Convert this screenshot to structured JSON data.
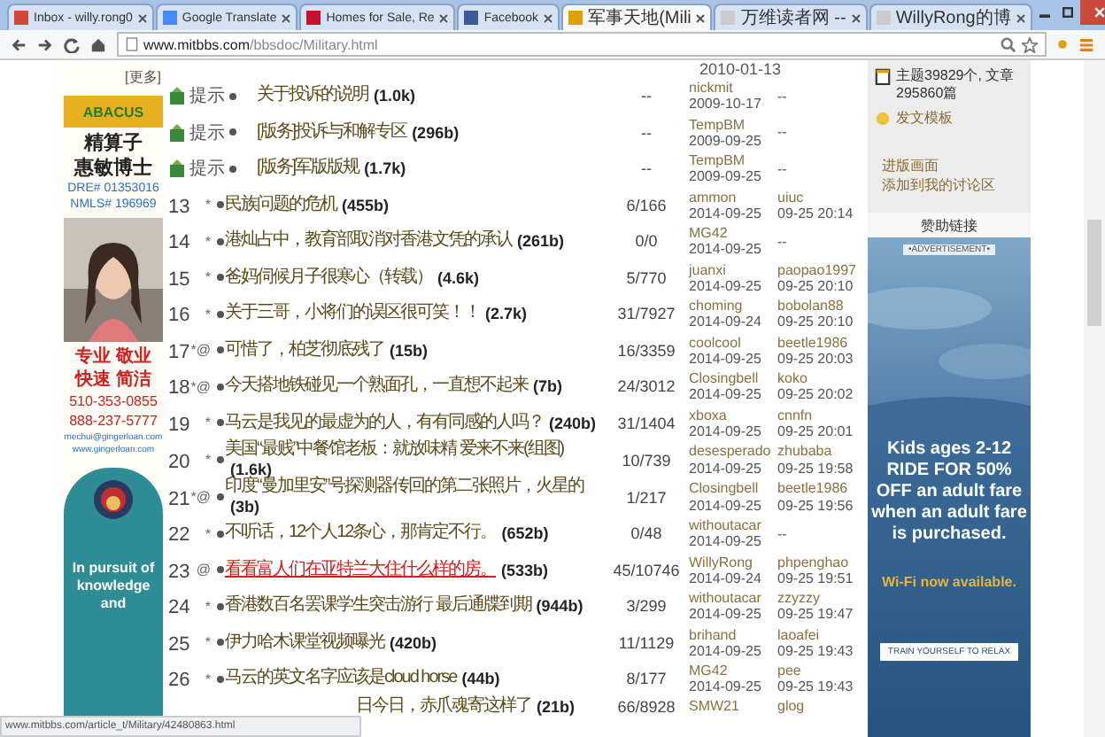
{
  "tabs": [
    {
      "label": "Inbox - willy.rong0",
      "selected": false,
      "color": "#d44638"
    },
    {
      "label": "Google Translate",
      "selected": false,
      "color": "#4a8af4"
    },
    {
      "label": "Homes for Sale, Re",
      "selected": false,
      "color": "#c8102e"
    },
    {
      "label": "Facebook",
      "selected": false,
      "color": "#3b5998"
    },
    {
      "label": "军事天地(Mili",
      "selected": true,
      "color": "#e0a000"
    },
    {
      "label": "万维读者网 --",
      "selected": false,
      "color": "#cccccc"
    },
    {
      "label": "WillyRong的博",
      "selected": false,
      "color": "#cccccc"
    }
  ],
  "address": {
    "host": "www.mitbbs.com",
    "path": "/bbsdoc/Military.html"
  },
  "left_ad": {
    "more": "[更多]",
    "logo": "ABACUS",
    "name_lines": [
      "精算子",
      "惠敏博士"
    ],
    "licenses": [
      "DRE# 01353016",
      "NMLS# 196969"
    ],
    "slogans": [
      "专业 敬业",
      "快速 简洁"
    ],
    "phones": [
      "510-353-0855",
      "888-237-5777"
    ],
    "email": "mechui@gingerloan.com",
    "site": "www.gingerloan.com",
    "motto": "In pursuit of knowledge and"
  },
  "top_date": "2010-01-13",
  "rows": [
    {
      "kind": "notice",
      "number": "",
      "tag": "提示",
      "marker": "",
      "title": "关于投诉的说明",
      "size": "(1.0k)",
      "stats": "--",
      "author": "nickmit",
      "date": "2009-10-17",
      "last_user": "",
      "last_time": "--",
      "visited": false
    },
    {
      "kind": "notice",
      "number": "",
      "tag": "提示",
      "marker": "",
      "title": "[版务]投诉与和解专区",
      "size": "(296b)",
      "stats": "--",
      "author": "TempBM",
      "date": "2009-09-25",
      "last_user": "",
      "last_time": "--",
      "visited": false
    },
    {
      "kind": "notice",
      "number": "",
      "tag": "提示",
      "marker": "",
      "title": "[版务]军版版规",
      "size": "(1.7k)",
      "stats": "--",
      "author": "TempBM",
      "date": "2009-09-25",
      "last_user": "",
      "last_time": "--",
      "visited": false
    },
    {
      "kind": "post",
      "number": "13",
      "tag": "",
      "marker": "*",
      "title": "民族问题的危机",
      "size": "(455b)",
      "stats": "6/166",
      "author": "ammon",
      "date": "2014-09-25",
      "last_user": "uiuc",
      "last_time": "09-25 20:14",
      "visited": false
    },
    {
      "kind": "post",
      "number": "14",
      "tag": "",
      "marker": "*",
      "title": "港灿占中，教育部取消对香港文凭的承认",
      "size": "(261b)",
      "stats": "0/0",
      "author": "MG42",
      "date": "2014-09-25",
      "last_user": "",
      "last_time": "--",
      "visited": false
    },
    {
      "kind": "post",
      "number": "15",
      "tag": "",
      "marker": "*",
      "title": "爸妈伺候月子很寒心（转载）",
      "size": "(4.6k)",
      "stats": "5/770",
      "author": "juanxi",
      "date": "2014-09-25",
      "last_user": "paopao1997",
      "last_time": "09-25 20:10",
      "visited": false
    },
    {
      "kind": "post",
      "number": "16",
      "tag": "",
      "marker": "*",
      "title": "关于三哥，小将们的误区很可笑！！",
      "size": "(2.7k)",
      "stats": "31/7927",
      "author": "choming",
      "date": "2014-09-24",
      "last_user": "bobolan88",
      "last_time": "09-25 20:10",
      "visited": false
    },
    {
      "kind": "post",
      "number": "17",
      "tag": "",
      "marker": "*@",
      "title": "可惜了，柏芝彻底残了",
      "size": "(15b)",
      "stats": "16/3359",
      "author": "coolcool",
      "date": "2014-09-25",
      "last_user": "beetle1986",
      "last_time": "09-25 20:03",
      "visited": false
    },
    {
      "kind": "post",
      "number": "18",
      "tag": "",
      "marker": "*@",
      "title": "今天搭地铁碰见一个熟面孔，一直想不起来",
      "size": "(7b)",
      "stats": "24/3012",
      "author": "Closingbell",
      "date": "2014-09-25",
      "last_user": "koko",
      "last_time": "09-25 20:02",
      "visited": false
    },
    {
      "kind": "post",
      "number": "19",
      "tag": "",
      "marker": "*",
      "title": "马云是我见的最虚为的人，有有同感的人吗？",
      "size": "(240b)",
      "stats": "31/1404",
      "author": "xboxa",
      "date": "2014-09-25",
      "last_user": "cnnfn",
      "last_time": "09-25 20:01",
      "visited": false
    },
    {
      "kind": "post",
      "number": "20",
      "tag": "",
      "marker": "*",
      "title": "美国“最贱”中餐馆老板：就放味精 爱来不来(组图)",
      "size": "(1.6k)",
      "stats": "10/739",
      "author": "desesperado",
      "date": "2014-09-25",
      "last_user": "zhubaba",
      "last_time": "09-25 19:58",
      "visited": false
    },
    {
      "kind": "post",
      "number": "21",
      "tag": "",
      "marker": "*@",
      "title": "印度“曼加里安”号探测器传回的第二张照片，火星的",
      "size": "(3b)",
      "stats": "1/217",
      "author": "Closingbell",
      "date": "2014-09-25",
      "last_user": "beetle1986",
      "last_time": "09-25 19:56",
      "visited": false
    },
    {
      "kind": "post",
      "number": "22",
      "tag": "",
      "marker": "*",
      "title": "不听话，12个人12条心，那肯定不行。",
      "size": "(652b)",
      "stats": "0/48",
      "author": "withoutacar",
      "date": "2014-09-25",
      "last_user": "",
      "last_time": "--",
      "visited": false
    },
    {
      "kind": "post",
      "number": "23",
      "tag": "",
      "marker": "@",
      "title": "看看富人们在亚特兰大住什么样的房。",
      "size": "(533b)",
      "stats": "45/10746",
      "author": "WillyRong",
      "date": "2014-09-24",
      "last_user": "phpenghao",
      "last_time": "09-25 19:51",
      "visited": true
    },
    {
      "kind": "post",
      "number": "24",
      "tag": "",
      "marker": "*",
      "title": "香港数百名罢课学生突击游行 最后通牒到期",
      "size": "(944b)",
      "stats": "3/299",
      "author": "withoutacar",
      "date": "2014-09-25",
      "last_user": "zzyzzy",
      "last_time": "09-25 19:47",
      "visited": false
    },
    {
      "kind": "post",
      "number": "25",
      "tag": "",
      "marker": "*",
      "title": "伊力哈木课堂视频曝光",
      "size": "(420b)",
      "stats": "11/1129",
      "author": "brihand",
      "date": "2014-09-25",
      "last_user": "laoafei",
      "last_time": "09-25 19:43",
      "visited": false
    },
    {
      "kind": "post",
      "number": "26",
      "tag": "",
      "marker": "*",
      "title": "马云的英文名字应该是cloud horse",
      "size": "(44b)",
      "stats": "8/177",
      "author": "MG42",
      "date": "2014-09-25",
      "last_user": "pee",
      "last_time": "09-25 19:43",
      "visited": false
    },
    {
      "kind": "cut",
      "number": "",
      "tag": "",
      "marker": "",
      "title": "日今日，赤爪魂寄这样了",
      "size": "(21b)",
      "stats": "66/8928",
      "author": "SMW21",
      "date": "",
      "last_user": "glog",
      "last_time": "",
      "visited": false
    }
  ],
  "board_info": {
    "counts": "主题39829个, 文章295860篇",
    "template": "发文模板",
    "links": [
      "进版画面",
      "添加到我的讨论区"
    ],
    "sponsor": "赞助链接"
  },
  "ad": {
    "label": "•ADVERTISEMENT•",
    "headline": "Kids ages 2-12 RIDE FOR 50% OFF an adult fare when an adult fare is purchased.",
    "wifi": "Wi-Fi now available.",
    "button": "TRAIN YOURSELF TO RELAX"
  },
  "status_url": "www.mitbbs.com/article_t/Military/42480863.html"
}
